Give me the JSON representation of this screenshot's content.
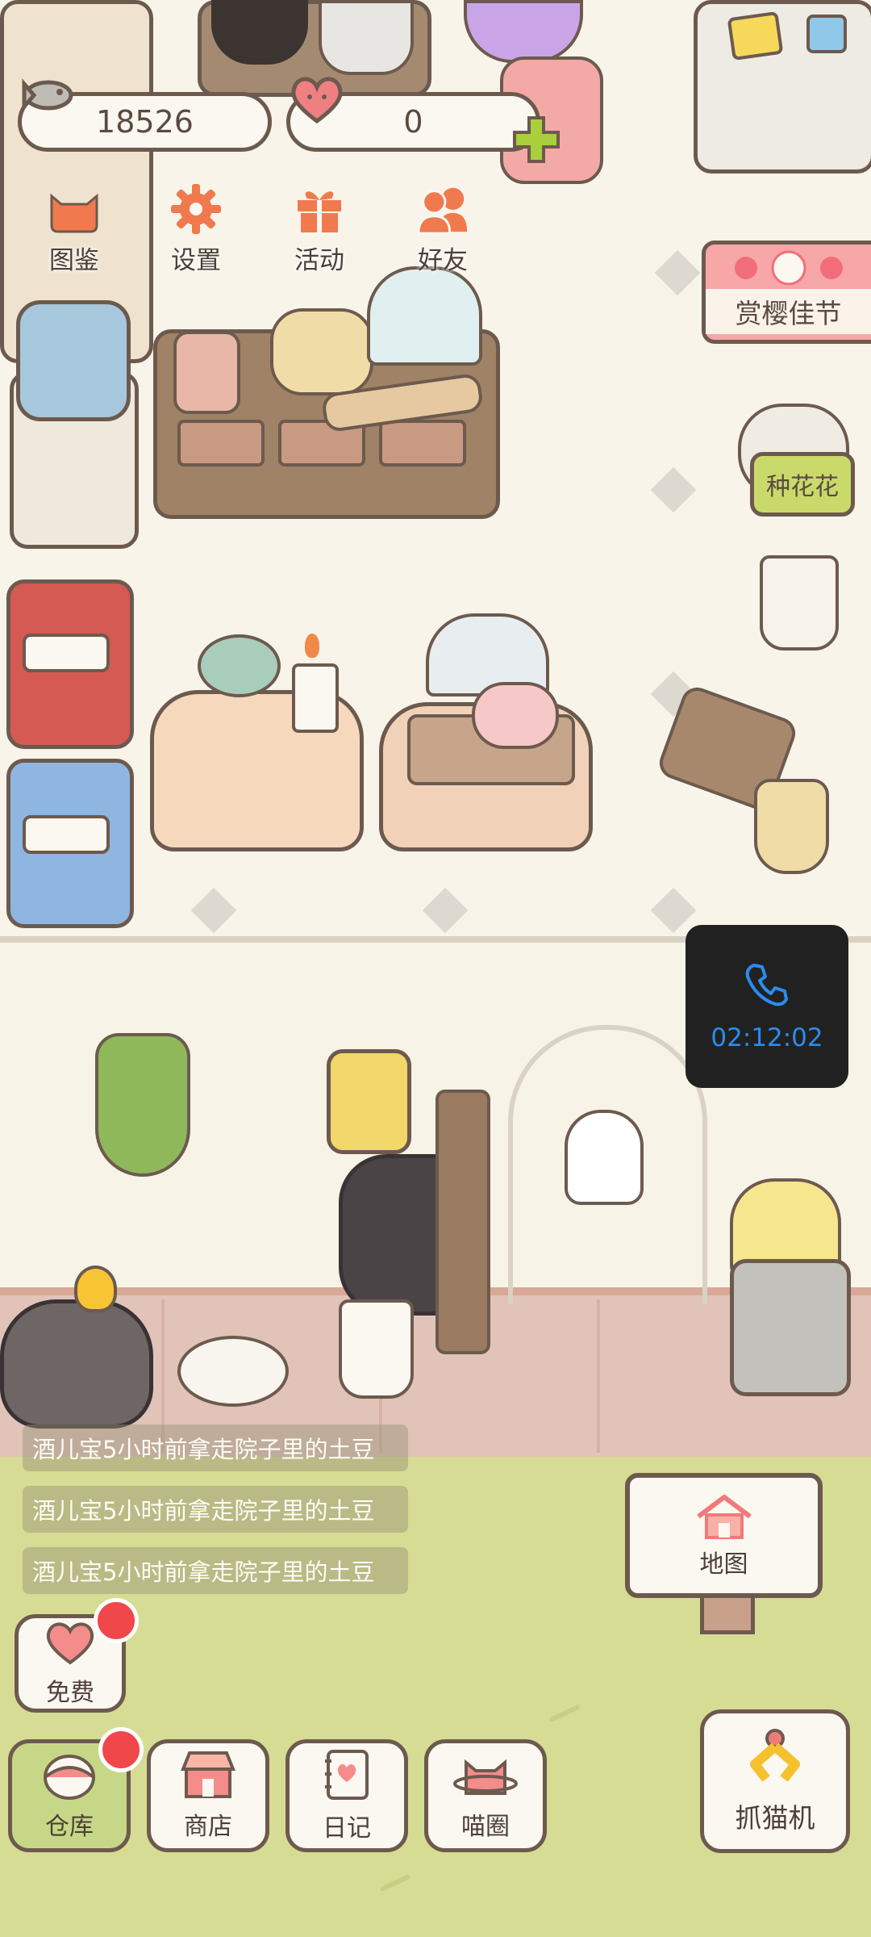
{
  "hud": {
    "fish_currency": "18526",
    "heart_currency": "0",
    "buttons": [
      {
        "label": "图鉴",
        "icon": "cat-face-icon"
      },
      {
        "label": "设置",
        "icon": "gear-icon"
      },
      {
        "label": "活动",
        "icon": "gift-icon"
      },
      {
        "label": "好友",
        "icon": "friends-icon"
      }
    ]
  },
  "events": {
    "sakura": "赏樱佳节",
    "flowers": "种花花"
  },
  "call": {
    "duration": "02:12:02"
  },
  "log": [
    "酒儿宝5小时前拿走院子里的土豆",
    "酒儿宝5小时前拿走院子里的土豆",
    "酒儿宝5小时前拿走院子里的土豆"
  ],
  "bottom": {
    "free": "免费",
    "warehouse": "仓库",
    "shop": "商店",
    "diary": "日记",
    "meow_circle": "喵圈",
    "map": "地图",
    "claw_machine": "抓猫机"
  },
  "colors": {
    "accent_orange": "#f07a4e",
    "notification_red": "#f0474a",
    "call_blue": "#2a8cf0",
    "outline_brown": "#6d5a4e",
    "yard_green": "#d7dc94"
  }
}
